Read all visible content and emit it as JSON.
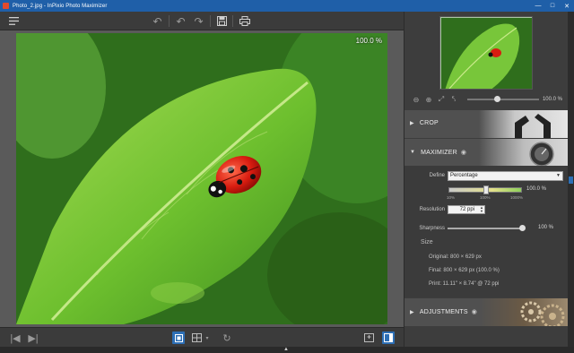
{
  "window": {
    "title": "Photo_2.jpg - InPixio Photo Maximizer",
    "controls": [
      "minimize-icon",
      "maximize-icon",
      "close-icon"
    ]
  },
  "toolbar": {
    "icons": [
      "menu-icon",
      "undo-icon",
      "undo-step-icon",
      "redo-icon",
      "save-icon",
      "print-icon"
    ]
  },
  "canvas": {
    "zoom_label": "100.0 %"
  },
  "bottombar": {
    "icons": [
      "first-photo-icon",
      "next-photo-icon",
      "fit-view-icon",
      "compare-view-icon",
      "rotate-icon",
      "export-icon",
      "panel-toggle-icon"
    ]
  },
  "navigator": {
    "zoom_value": "100.0 %",
    "zoom_fraction": 0.4
  },
  "sections": {
    "crop": "CROP",
    "maximizer": "MAXIMIZER",
    "adjustments": "ADJUSTMENTS"
  },
  "maximizer": {
    "define_label": "Define",
    "define_value": "Percentage",
    "percentage_value": "100.0 %",
    "scale_ticks": [
      "10%",
      "100%",
      "1000%"
    ],
    "scale_fraction": 0.5,
    "resolution_label": "Resolution",
    "resolution_value": "72 ppi",
    "sharpness_label": "Sharpness",
    "sharpness_value": "100 %",
    "sharpness_fraction": 1.0,
    "size_heading": "Size",
    "original": "Original: 800 × 629 px",
    "final": "Final: 800 × 629 px (100.0 %)",
    "print": "Print: 11.11\" × 8.74\" @ 72 ppi"
  },
  "colors": {
    "titlebar": "#1f5fa8",
    "accent": "#2d6fb5",
    "panel": "#3d3d3d"
  }
}
